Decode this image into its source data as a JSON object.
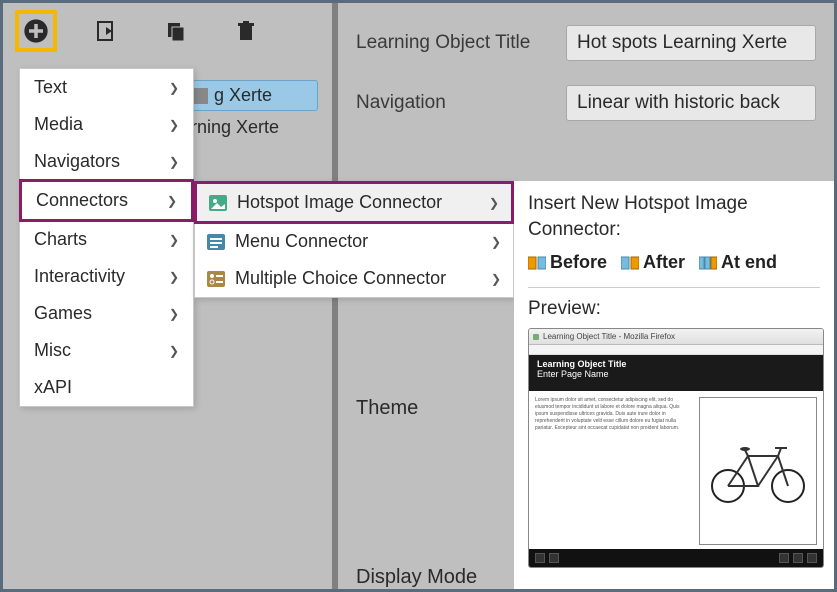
{
  "toolbar": {
    "add_icon": "plus-circle",
    "import_icon": "import",
    "copy_icon": "copy",
    "delete_icon": "trash"
  },
  "tree": {
    "root_label_partial": "g Xerte",
    "child_label_partial": "rning Xerte"
  },
  "properties": {
    "title_label": "Learning Object Title",
    "title_value": "Hot spots Learning Xerte",
    "nav_label": "Navigation",
    "nav_value": "Linear with historic back",
    "theme_label": "Theme",
    "display_mode_label": "Display Mode"
  },
  "menu": {
    "items": [
      {
        "label": "Text"
      },
      {
        "label": "Media"
      },
      {
        "label": "Navigators"
      },
      {
        "label": "Connectors",
        "highlighted": true
      },
      {
        "label": "Charts"
      },
      {
        "label": "Interactivity"
      },
      {
        "label": "Games"
      },
      {
        "label": "Misc"
      },
      {
        "label": "xAPI"
      }
    ]
  },
  "submenu": {
    "items": [
      {
        "label": "Hotspot Image Connector",
        "highlighted": true,
        "icon": "image"
      },
      {
        "label": "Menu Connector",
        "icon": "menu"
      },
      {
        "label": "Multiple Choice Connector",
        "icon": "choice"
      }
    ]
  },
  "insert_popup": {
    "title": "Insert New Hotspot Image Connector:",
    "actions": {
      "before": "Before",
      "after": "After",
      "at_end": "At end"
    },
    "preview_label": "Preview:",
    "preview_window_title": "Learning Object Title - Mozilla Firefox",
    "preview_header_l1": "Learning Object Title",
    "preview_header_l2": "Enter Page Name",
    "preview_lorem": "Lorem ipsum dolor sit amet, consectetur adipiscing elit, sed do eiusmod tempor incididunt ut labore et dolore magna aliqua. Quis ipsum suspendisse ultrices gravida. Duis aute irure dolor in reprehenderit in voluptate velit esse cillum dolore eu fugiat nulla pariatur. Excepteur sint occaecat cupidatat non proident laborum."
  }
}
